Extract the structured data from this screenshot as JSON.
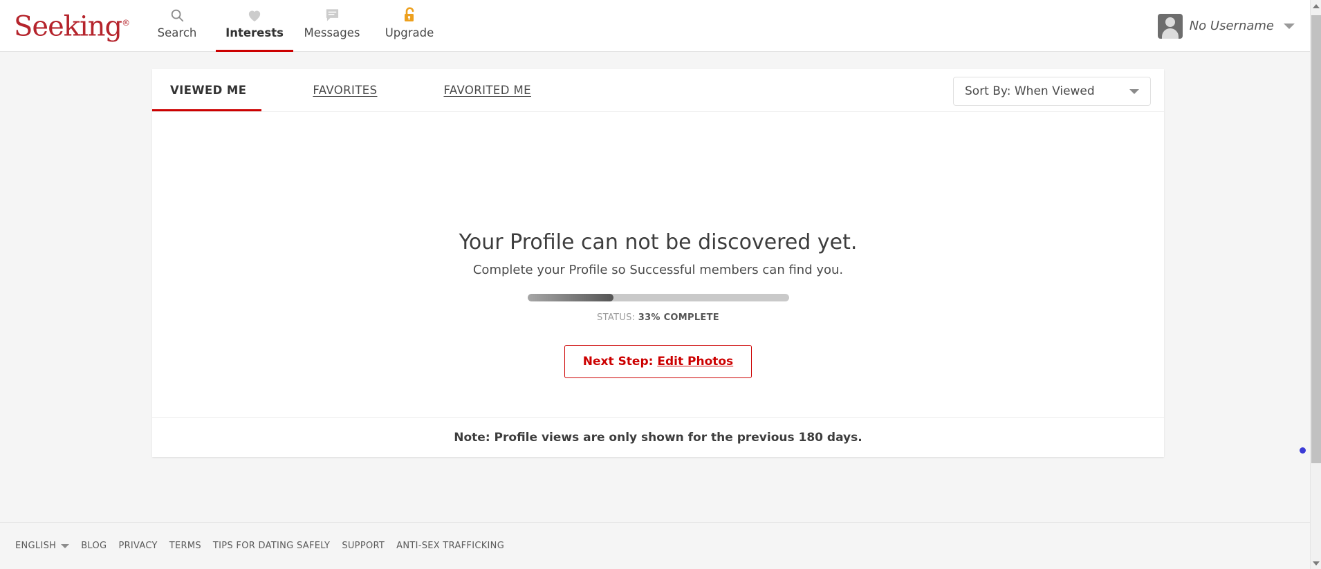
{
  "brand": {
    "logo_text": "Seeking",
    "logo_mark": "®",
    "accent_red": "#cc0000",
    "logo_red": "#b5242c",
    "upgrade_gold": "#eda01e"
  },
  "header": {
    "nav": [
      {
        "label": "Search",
        "icon": "search-icon",
        "active": false
      },
      {
        "label": "Interests",
        "icon": "heart-icon",
        "active": true
      },
      {
        "label": "Messages",
        "icon": "message-icon",
        "active": false
      },
      {
        "label": "Upgrade",
        "icon": "unlock-icon",
        "active": false
      }
    ],
    "account": {
      "username": "No Username",
      "avatar_icon": "avatar-placeholder-icon",
      "caret_icon": "chevron-down-icon"
    }
  },
  "tabs": [
    {
      "label": "VIEWED ME",
      "active": true
    },
    {
      "label": "FAVORITES",
      "active": false
    },
    {
      "label": "FAVORITED ME",
      "active": false
    }
  ],
  "sort": {
    "label": "Sort By: When Viewed",
    "caret_icon": "caret-down-icon",
    "options": [
      "Sort By: When Viewed"
    ]
  },
  "empty_state": {
    "title": "Your Profile can not be discovered yet.",
    "subtitle": "Complete your Profile so Successful members can find you.",
    "progress_percent": 33,
    "status_prefix": "STATUS: ",
    "status_value": "33% COMPLETE",
    "cta_prefix": "Next Step: ",
    "cta_link": "Edit Photos"
  },
  "note": "Note: Profile views are only shown for the previous 180 days.",
  "footer": {
    "language": "ENGLISH",
    "language_caret_icon": "caret-down-icon",
    "links": [
      "BLOG",
      "PRIVACY",
      "TERMS",
      "TIPS FOR DATING SAFELY",
      "SUPPORT",
      "ANTI-SEX TRAFFICKING"
    ]
  }
}
